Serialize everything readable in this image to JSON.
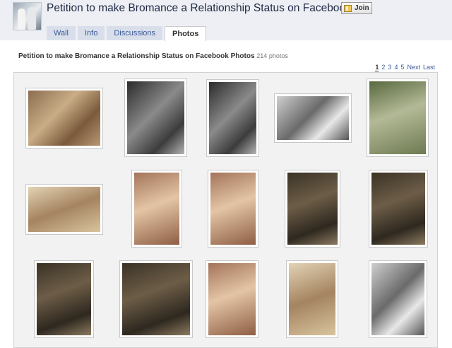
{
  "header": {
    "title": "Petition to make Bromance a Relationship Status on Facebook",
    "join_label": "Join"
  },
  "tabs": [
    {
      "label": "Wall",
      "active": false
    },
    {
      "label": "Info",
      "active": false
    },
    {
      "label": "Discussions",
      "active": false
    },
    {
      "label": "Photos",
      "active": true
    }
  ],
  "photos_section": {
    "title": "Petition to make Bromance a Relationship Status on Facebook Photos",
    "count": "214 photos"
  },
  "pager": {
    "pages": [
      "1",
      "2",
      "3",
      "4",
      "5"
    ],
    "current": "1",
    "next_label": "Next",
    "last_label": "Last"
  },
  "colors": {
    "header_bg": "#edeff4",
    "link": "#3b5998",
    "tab_bg": "#d8dfea"
  },
  "photos": [
    {
      "name": "photo-1"
    },
    {
      "name": "photo-2"
    },
    {
      "name": "photo-3"
    },
    {
      "name": "photo-4"
    },
    {
      "name": "photo-5"
    },
    {
      "name": "photo-6"
    },
    {
      "name": "photo-7"
    },
    {
      "name": "photo-8"
    },
    {
      "name": "photo-9"
    },
    {
      "name": "photo-10"
    },
    {
      "name": "photo-11"
    },
    {
      "name": "photo-12"
    },
    {
      "name": "photo-13"
    },
    {
      "name": "photo-14"
    },
    {
      "name": "photo-15"
    }
  ]
}
